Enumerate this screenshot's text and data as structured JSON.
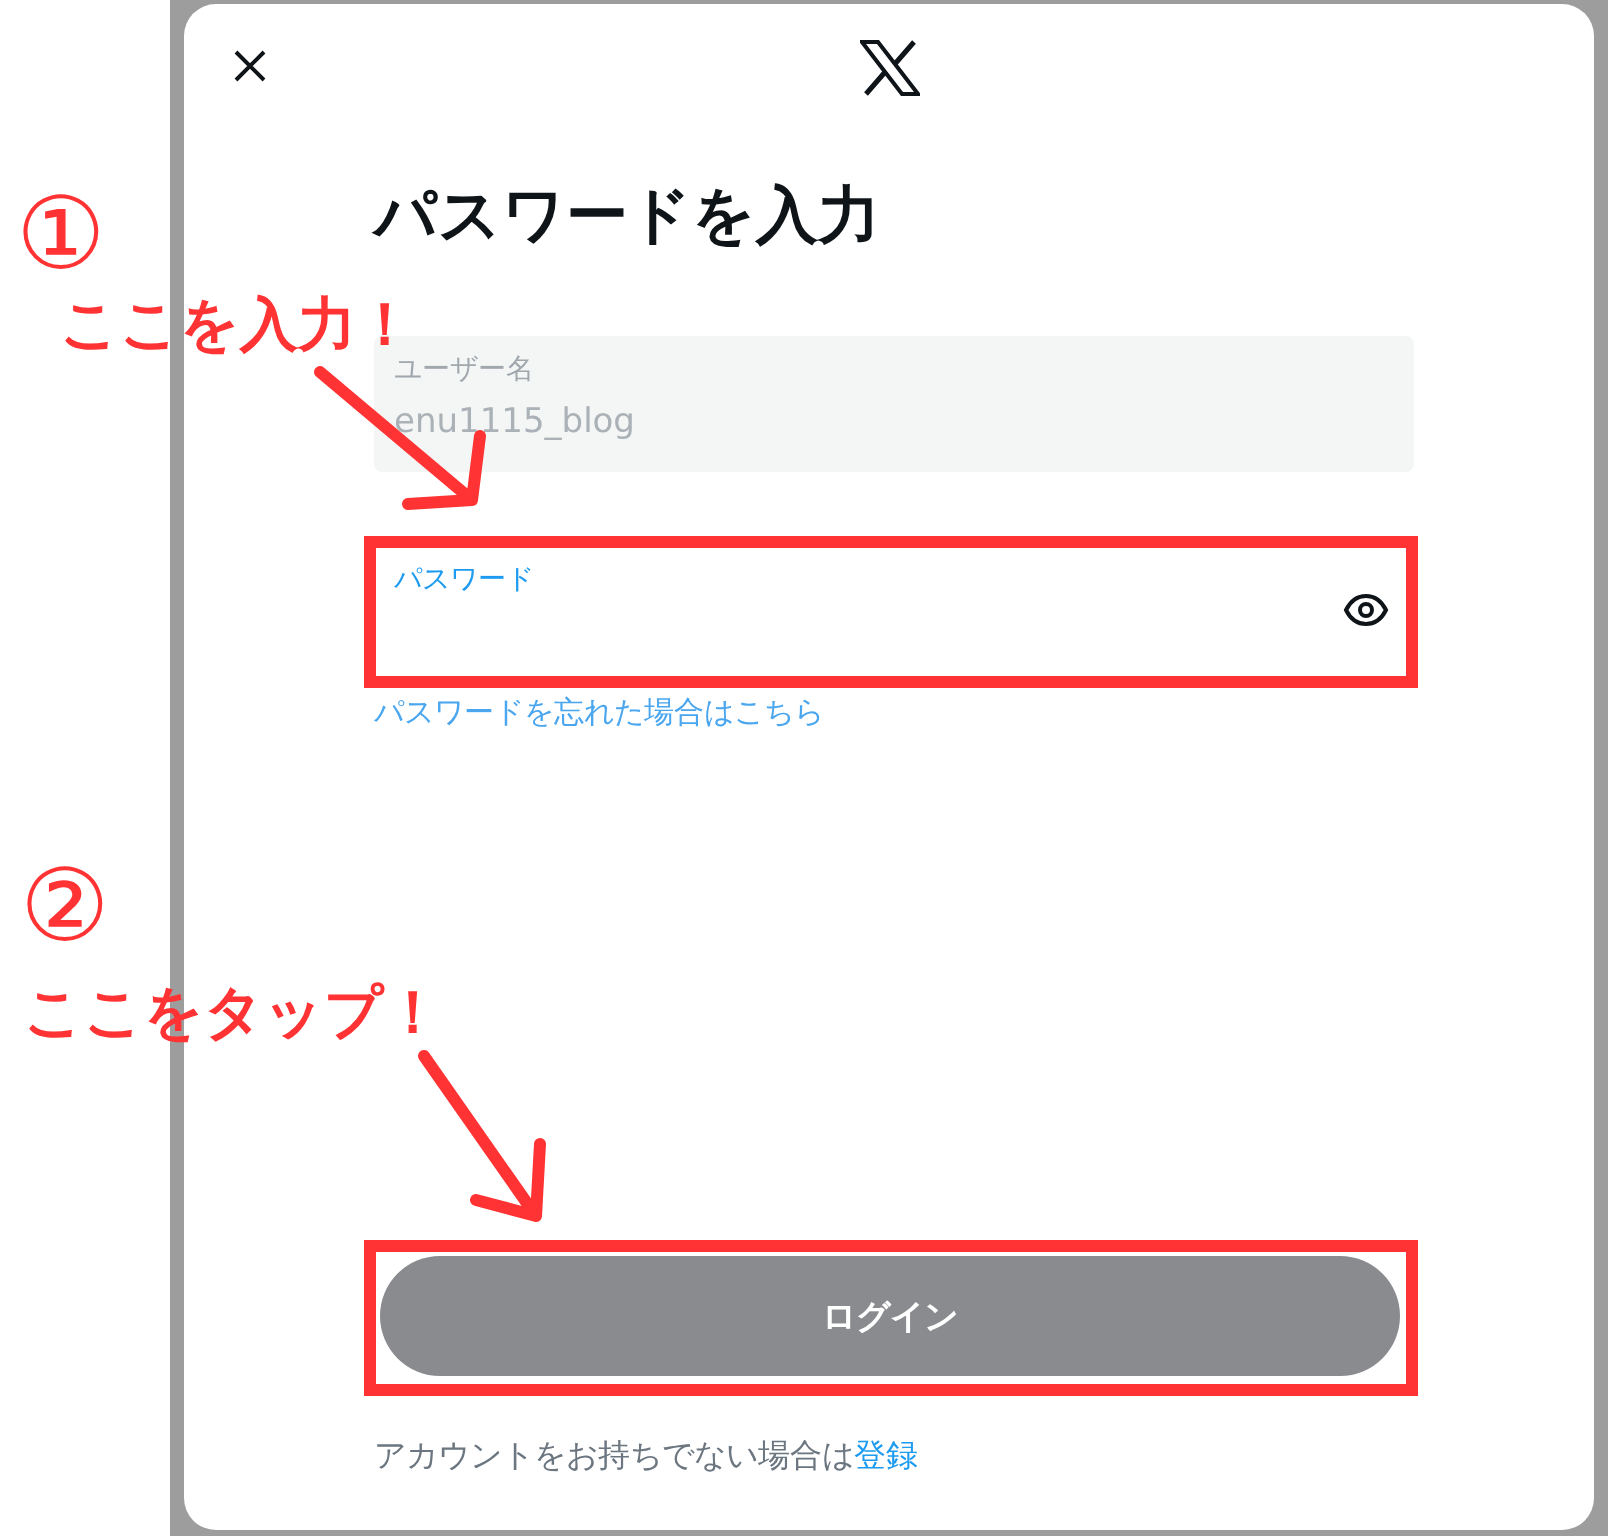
{
  "dialog": {
    "title": "パスワードを入力",
    "fields": [
      {
        "kind": "username",
        "label": "ユーザー名",
        "value": "enu1115_blog",
        "disabled": true
      },
      {
        "kind": "password",
        "label": "パスワード",
        "focused": true
      }
    ],
    "forgot_link": "パスワードを忘れた場合はこちら",
    "login_button": {
      "label": "ログイン",
      "disabled": true
    },
    "footer": {
      "text": "アカウントをお持ちでない場合は",
      "link": "登録"
    }
  },
  "annotations": [
    {
      "number": "①",
      "text": "ここを入力！"
    },
    {
      "number": "②",
      "text": "ここをタップ！"
    }
  ]
}
